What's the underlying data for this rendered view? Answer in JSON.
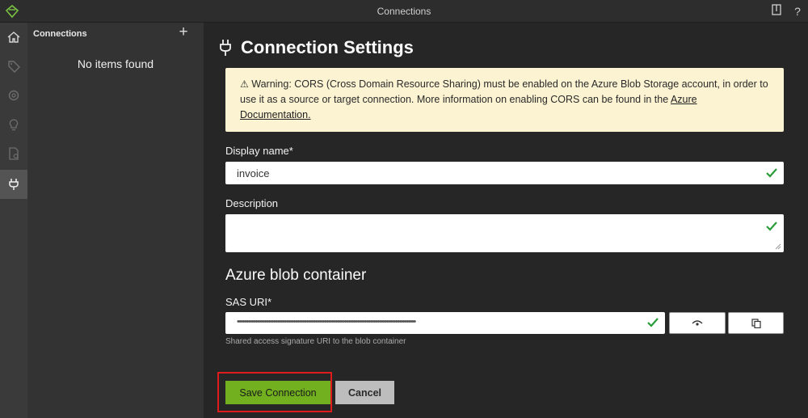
{
  "window": {
    "title": "Connections"
  },
  "sidebar": {
    "items": [
      {
        "icon": "home-icon"
      },
      {
        "icon": "tag-icon"
      },
      {
        "icon": "ai-model-icon"
      },
      {
        "icon": "lightbulb-icon"
      },
      {
        "icon": "document-check-icon"
      },
      {
        "icon": "plug-icon",
        "active": true
      }
    ]
  },
  "connections_pane": {
    "header": "Connections",
    "add_label": "+",
    "empty_text": "No items found"
  },
  "settings": {
    "title": "Connection Settings",
    "warning": {
      "icon": "⚠",
      "text": "Warning: CORS (Cross Domain Resource Sharing) must be enabled on the Azure Blob Storage account, in order to use it as a source or target connection. More information on enabling CORS can be found in the",
      "link_text": "Azure Documentation."
    },
    "display_name": {
      "label": "Display name*",
      "value": "invoice"
    },
    "description": {
      "label": "Description",
      "value": ""
    },
    "section_title": "Azure blob container",
    "sas_uri": {
      "label": "SAS URI*",
      "masked_value": "••••••••••••••••••••••••••••••••••••••••••••••••••••••••••••••••••••••••••••••••••••••••••••••••••",
      "help": "Shared access signature URI to the blob container"
    },
    "save_label": "Save Connection",
    "cancel_label": "Cancel"
  },
  "colors": {
    "accent_green": "#72b020",
    "check_green": "#2a9d3a",
    "warning_bg": "#fcf3d2",
    "highlight_red": "#e01b1b"
  }
}
